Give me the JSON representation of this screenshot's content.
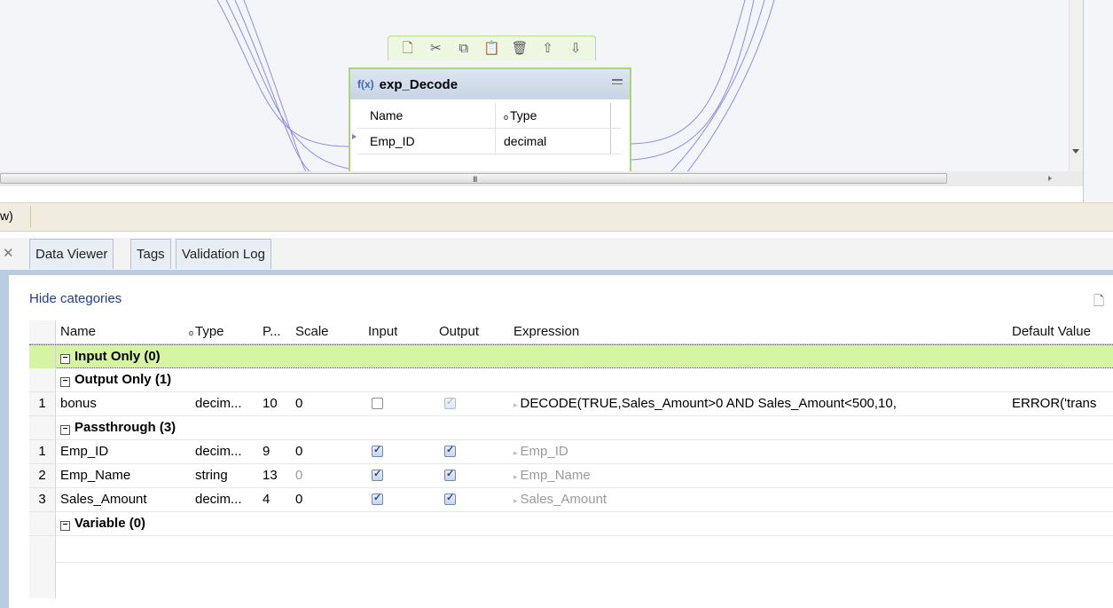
{
  "node": {
    "fx_label": "f(x)",
    "title": "exp_Decode",
    "columns": {
      "name": "Name",
      "type": "Type"
    },
    "rows": [
      {
        "name": "Emp_ID",
        "type": "decimal"
      }
    ]
  },
  "node_toolbar": {
    "icons": [
      "new-port-icon",
      "cut-icon",
      "copy-icon",
      "paste-icon",
      "delete-icon",
      "move-up-icon",
      "move-down-icon"
    ]
  },
  "canvas": {
    "hscroll_grip": "III"
  },
  "expression_bar": {
    "label": "w)"
  },
  "tabs": [
    {
      "label": "Data Viewer"
    },
    {
      "label": "Tags"
    },
    {
      "label": "Validation Log"
    }
  ],
  "panel": {
    "hide_categories": "Hide categories",
    "columns": [
      "Name",
      "Type",
      "P...",
      "Scale",
      "Input",
      "Output",
      "Expression",
      "Default Value"
    ],
    "categories": [
      {
        "label": "Input Only (0)",
        "highlight": true,
        "rows": []
      },
      {
        "label": "Output Only (1)",
        "rows": [
          {
            "num": "1",
            "name": "bonus",
            "type": "decim...",
            "precision": "10",
            "scale": "0",
            "input": false,
            "output": true,
            "expression": "DECODE(TRUE,Sales_Amount>0  AND Sales_Amount<500,10,",
            "default": "ERROR('trans"
          }
        ]
      },
      {
        "label": "Passthrough (3)",
        "rows": [
          {
            "num": "1",
            "name": "Emp_ID",
            "type": "decim...",
            "precision": "9",
            "scale": "0",
            "input": true,
            "output": true,
            "expression": "Emp_ID",
            "default": ""
          },
          {
            "num": "2",
            "name": "Emp_Name",
            "type": "string",
            "precision": "13",
            "scale": "0",
            "input": true,
            "output": true,
            "expression": "Emp_Name",
            "default": ""
          },
          {
            "num": "3",
            "name": "Sales_Amount",
            "type": "decim...",
            "precision": "4",
            "scale": "0",
            "input": true,
            "output": true,
            "expression": "Sales_Amount",
            "default": ""
          }
        ]
      },
      {
        "label": "Variable (0)",
        "rows": []
      }
    ]
  },
  "colors": {
    "accent_link": "#1c3f94",
    "node_border": "#a8d77b",
    "category_highlight": "#d6f5a3",
    "wire": "#7a7ae0"
  }
}
